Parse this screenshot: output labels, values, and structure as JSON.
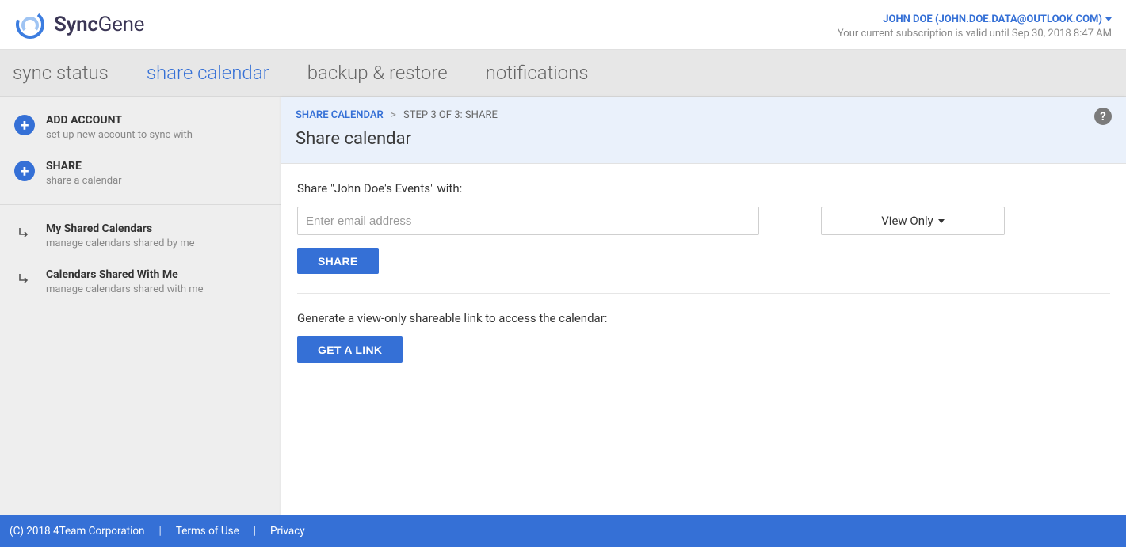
{
  "brand": {
    "name1": "Sync",
    "name2": "Gene"
  },
  "user": {
    "display": "JOHN DOE (JOHN.DOE.DATA@OUTLOOK.COM)",
    "subscription": "Your current subscription is valid until Sep 30, 2018 8:47 AM"
  },
  "nav": {
    "items": [
      {
        "label": "sync status"
      },
      {
        "label": "share calendar"
      },
      {
        "label": "backup & restore"
      },
      {
        "label": "notifications"
      }
    ],
    "active_index": 1
  },
  "sidebar": {
    "primary": [
      {
        "title": "ADD ACCOUNT",
        "sub": "set up new account to sync with",
        "icon": "plus-icon"
      },
      {
        "title": "SHARE",
        "sub": "share a calendar",
        "icon": "plus-icon"
      }
    ],
    "secondary": [
      {
        "title": "My Shared Calendars",
        "sub": "manage calendars shared by me",
        "icon": "arrow-sub-icon"
      },
      {
        "title": "Calendars Shared With Me",
        "sub": "manage calendars shared with me",
        "icon": "arrow-sub-icon"
      }
    ]
  },
  "panel": {
    "breadcrumb": {
      "root": "SHARE CALENDAR",
      "step": "STEP 3 OF 3: SHARE"
    },
    "title": "Share calendar",
    "share_with_label": "Share \"John Doe's Events\" with:",
    "email_placeholder": "Enter email address",
    "permission_selected": "View Only",
    "share_button": "SHARE",
    "link_label": "Generate a view-only shareable link to access the calendar:",
    "link_button": "GET A LINK"
  },
  "footer": {
    "copyright": "(C) 2018  4Team Corporation",
    "terms": "Terms of Use",
    "privacy": "Privacy"
  }
}
